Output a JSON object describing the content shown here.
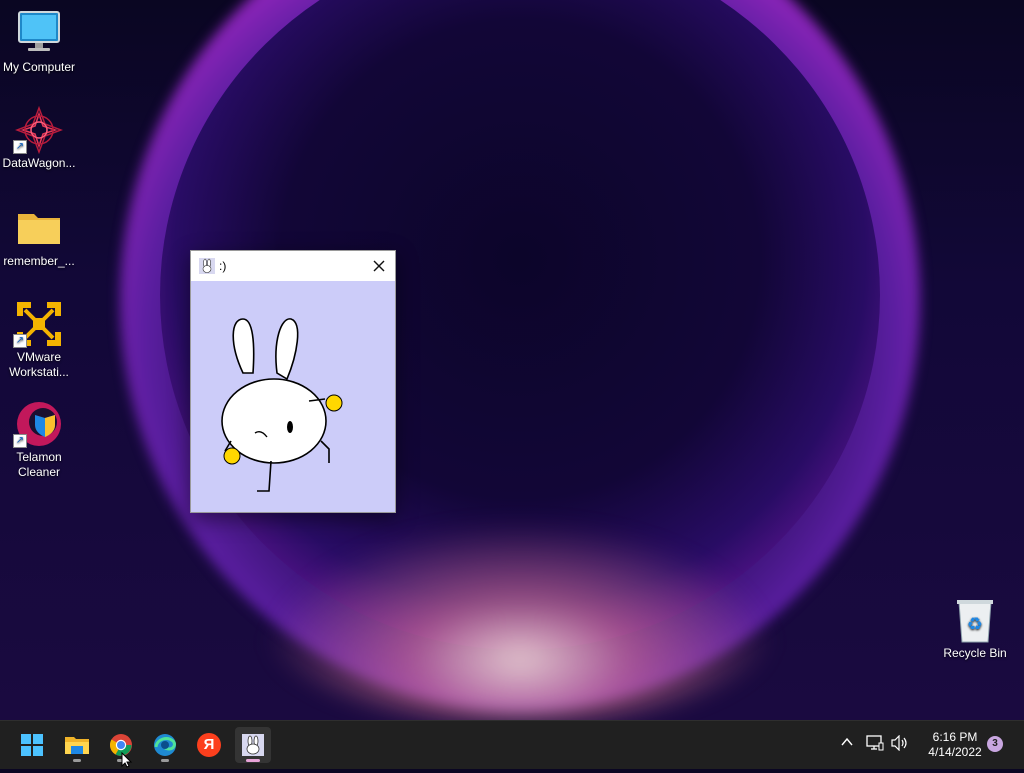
{
  "desktop": {
    "icons": [
      {
        "label": "My Computer"
      },
      {
        "label": "DataWagon..."
      },
      {
        "label": "remember_..."
      },
      {
        "label": "VMware Workstati..."
      },
      {
        "label": "Telamon Cleaner"
      },
      {
        "label": "Recycle Bin"
      }
    ]
  },
  "window": {
    "title": ":)",
    "icon": "bunny-icon",
    "close_icon": "close-icon"
  },
  "taskbar": {
    "apps": [
      {
        "icon": "windows-start-icon"
      },
      {
        "icon": "file-explorer-icon"
      },
      {
        "icon": "chrome-icon"
      },
      {
        "icon": "edge-icon"
      },
      {
        "icon": "yandex-icon",
        "glyph": "Я"
      },
      {
        "icon": "bunny-app-icon"
      }
    ],
    "tray": {
      "time": "6:16 PM",
      "date": "4/14/2022",
      "notifications": "3"
    }
  },
  "colors": {
    "taskbar_bg": "#202020",
    "window_canvas": "#ccccf9",
    "bunny_ball": "#ffd700"
  }
}
